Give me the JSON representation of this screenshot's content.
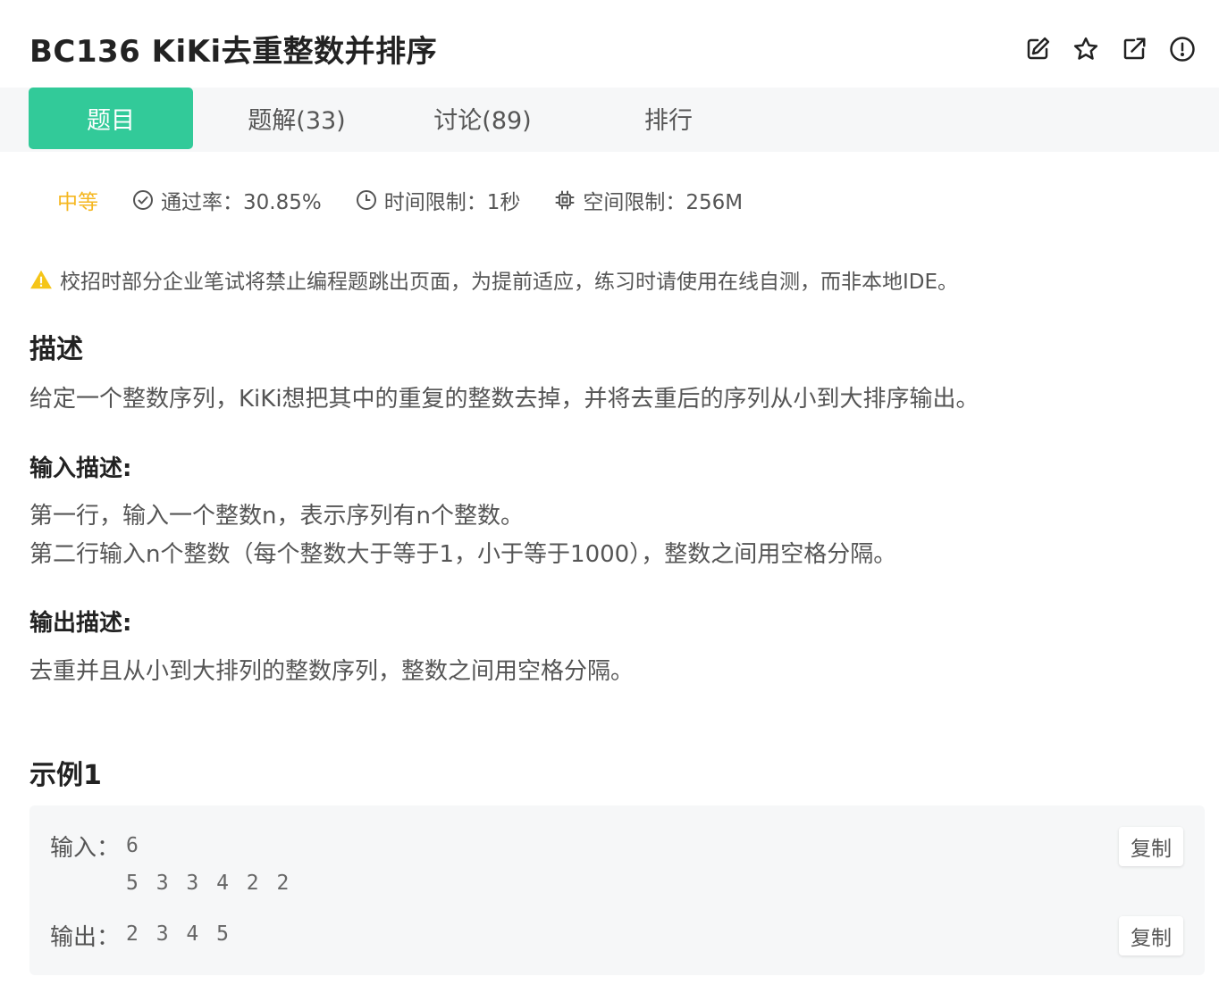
{
  "header": {
    "title": "BC136  KiKi去重整数并排序",
    "icons": [
      "edit-icon",
      "star-icon",
      "open-external-icon",
      "report-icon"
    ]
  },
  "tabs": [
    {
      "label": "题目",
      "active": true
    },
    {
      "label": "题解(33)",
      "active": false
    },
    {
      "label": "讨论(89)",
      "active": false
    },
    {
      "label": "排行",
      "active": false
    }
  ],
  "meta": {
    "difficulty": "中等",
    "pass_rate": "通过率：30.85%",
    "time_limit": "时间限制：1秒",
    "memory_limit": "空间限制：256M"
  },
  "warning": "校招时部分企业笔试将禁止编程题跳出页面，为提前适应，练习时请使用在线自测，而非本地IDE。",
  "description": {
    "heading": "描述",
    "text": "给定一个整数序列，KiKi想把其中的重复的整数去掉，并将去重后的序列从小到大排序输出。"
  },
  "input_desc": {
    "heading": "输入描述:",
    "lines": [
      "第一行，输入一个整数n，表示序列有n个整数。",
      "第二行输入n个整数（每个整数大于等于1，小于等于1000），整数之间用空格分隔。"
    ]
  },
  "output_desc": {
    "heading": "输出描述:",
    "text": "去重并且从小到大排列的整数序列，整数之间用空格分隔。"
  },
  "example": {
    "heading": "示例1",
    "input_label": "输入：",
    "input_value": "6\n5 3 3 4 2 2",
    "output_label": "输出：",
    "output_value": "2 3 4 5",
    "copy_label": "复制"
  },
  "colors": {
    "accent": "#32ca99",
    "difficulty": "#f5b720",
    "warning": "#f5c518"
  }
}
